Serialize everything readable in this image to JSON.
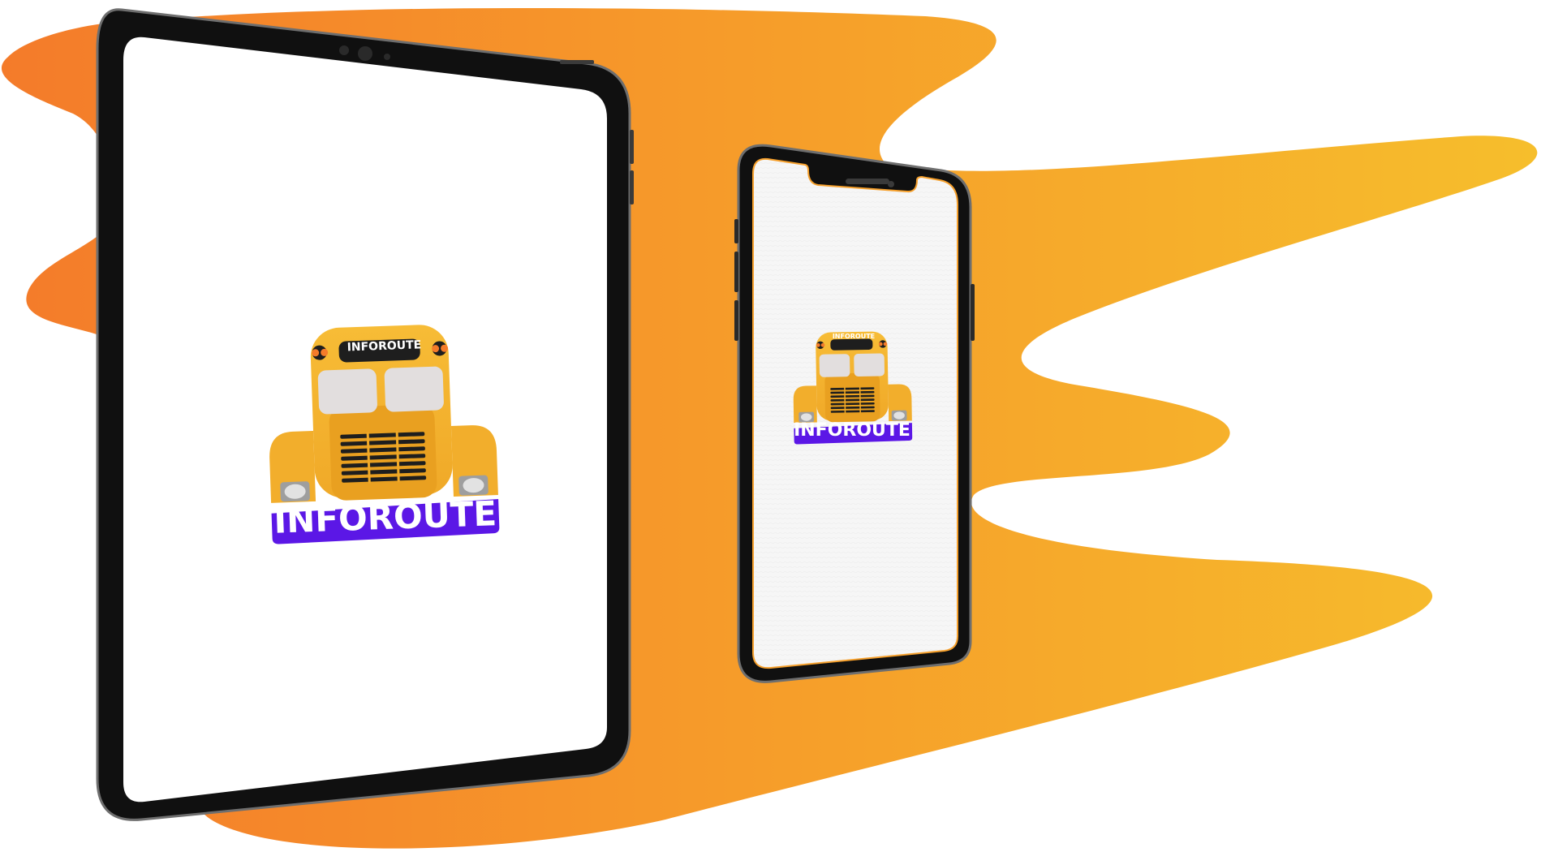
{
  "brand": {
    "name": "INFOROUTE",
    "bus_sign_text": "INFOROUTE"
  },
  "colors": {
    "splash_start": "#F47B2A",
    "splash_mid": "#F69A2A",
    "splash_end": "#F6BE2C",
    "bus_yellow": "#F6B72F",
    "bus_dark_yellow": "#E99F21",
    "bus_window": "#E2DEDE",
    "label_purple": "#5B17E6",
    "device_frame": "#0A0A0A",
    "screen_bg": "#FFFFFF"
  },
  "devices": {
    "tablet": {
      "logo_label": "INFOROUTE",
      "bus_sign": "INFOROUTE"
    },
    "phone": {
      "logo_label": "INFOROUTE",
      "bus_sign": "INFOROUTE"
    }
  }
}
